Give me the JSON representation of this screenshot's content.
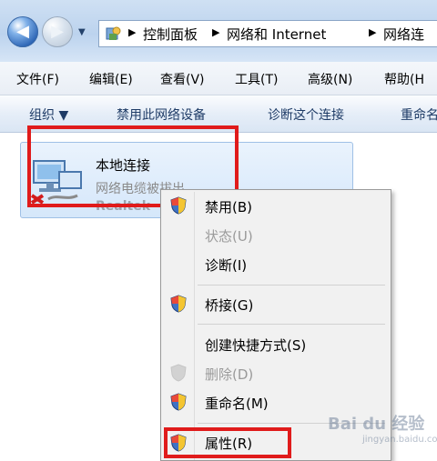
{
  "address": {
    "crumbs": [
      "控制面板",
      "网络和 Internet",
      "网络连"
    ]
  },
  "menubar": {
    "items": [
      "文件(F)",
      "编辑(E)",
      "查看(V)",
      "工具(T)",
      "高级(N)",
      "帮助(H"
    ]
  },
  "cmdbar": {
    "organize": "组织 ▼",
    "disable": "禁用此网络设备",
    "diagnose": "诊断这个连接",
    "rename": "重命名"
  },
  "connection": {
    "name": "本地连接",
    "status": "网络电缆被拔出",
    "adapter": "Realtek"
  },
  "context_menu": {
    "items": [
      {
        "label": "禁用(B)",
        "disabled": false
      },
      {
        "label": "状态(U)",
        "disabled": true
      },
      {
        "label": "诊断(I)",
        "disabled": false
      },
      {
        "label": "桥接(G)",
        "disabled": false
      },
      {
        "label": "创建快捷方式(S)",
        "disabled": false
      },
      {
        "label": "删除(D)",
        "disabled": true
      },
      {
        "label": "重命名(M)",
        "disabled": false
      },
      {
        "label": "属性(R)",
        "disabled": false
      }
    ]
  },
  "watermark": {
    "text": "Bai du 经验",
    "sub": "jingyan.baidu.com"
  },
  "colors": {
    "highlight_red": "#e01b1b",
    "selection_blue": "#d5e7fa"
  }
}
